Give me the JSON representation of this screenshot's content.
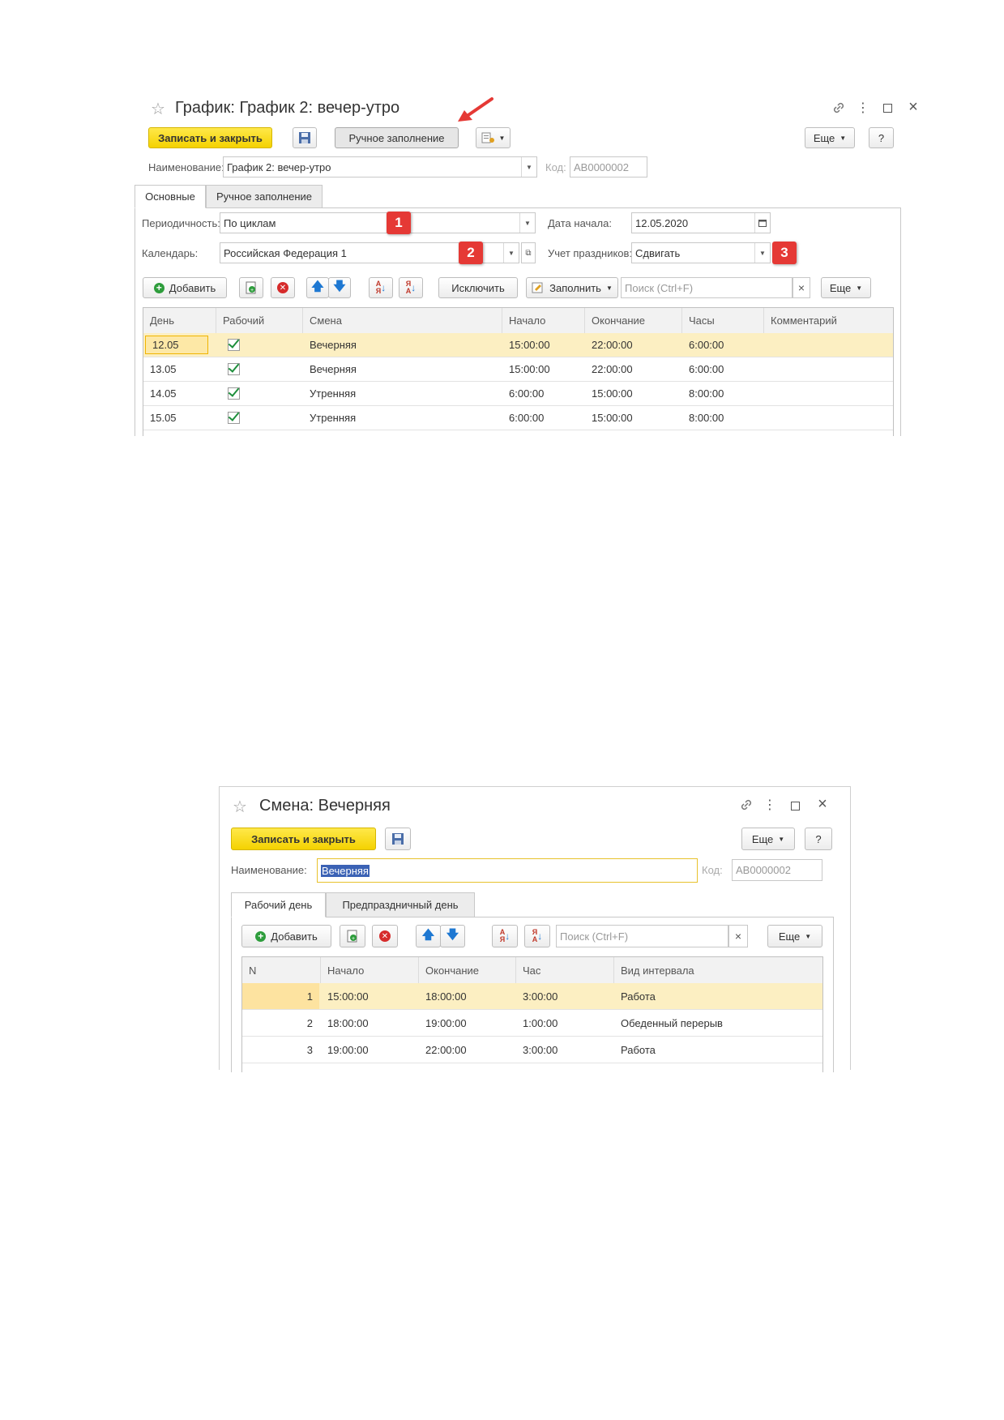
{
  "window1": {
    "title": "График: График 2: вечер-утро",
    "toolbar": {
      "save_close": "Записать и закрыть",
      "manual_fill": "Ручное заполнение",
      "more": "Еще",
      "help": "?"
    },
    "name_label": "Наименование:",
    "name_value": "График 2: вечер-утро",
    "code_label": "Код:",
    "code_value": "АВ0000002",
    "tabs": [
      "Основные",
      "Ручное заполнение"
    ],
    "periodicity_label": "Периодичность:",
    "periodicity_value": "По циклам",
    "start_date_label": "Дата начала:",
    "start_date_value": "12.05.2020",
    "calendar_label": "Календарь:",
    "calendar_value": "Российская Федерация 1",
    "holidays_label": "Учет праздников:",
    "holidays_value": "Сдвигать",
    "badges": [
      "1",
      "2",
      "3"
    ],
    "table_toolbar": {
      "add": "Добавить",
      "exclude": "Исключить",
      "fill": "Заполнить",
      "search_placeholder": "Поиск (Ctrl+F)",
      "clear": "×",
      "more": "Еще"
    },
    "columns": [
      "День",
      "Рабочий",
      "Смена",
      "Начало",
      "Окончание",
      "Часы",
      "Комментарий"
    ],
    "rows": [
      {
        "day": "12.05",
        "shift": "Вечерняя",
        "start": "15:00:00",
        "end": "22:00:00",
        "hours": "6:00:00"
      },
      {
        "day": "13.05",
        "shift": "Вечерняя",
        "start": "15:00:00",
        "end": "22:00:00",
        "hours": "6:00:00"
      },
      {
        "day": "14.05",
        "shift": "Утренняя",
        "start": "6:00:00",
        "end": "15:00:00",
        "hours": "8:00:00"
      },
      {
        "day": "15.05",
        "shift": "Утренняя",
        "start": "6:00:00",
        "end": "15:00:00",
        "hours": "8:00:00"
      }
    ]
  },
  "window2": {
    "title": "Смена: Вечерняя",
    "toolbar": {
      "save_close": "Записать и закрыть",
      "more": "Еще",
      "help": "?"
    },
    "name_label": "Наименование:",
    "name_value": "Вечерняя",
    "code_label": "Код:",
    "code_value": "АВ0000002",
    "tabs": [
      "Рабочий день",
      "Предпраздничный день"
    ],
    "table_toolbar": {
      "add": "Добавить",
      "search_placeholder": "Поиск (Ctrl+F)",
      "clear": "×",
      "more": "Еще"
    },
    "columns": [
      "N",
      "Начало",
      "Окончание",
      "Час",
      "Вид интервала"
    ],
    "rows": [
      {
        "n": "1",
        "start": "15:00:00",
        "end": "18:00:00",
        "hours": "3:00:00",
        "type": "Работа"
      },
      {
        "n": "2",
        "start": "18:00:00",
        "end": "19:00:00",
        "hours": "1:00:00",
        "type": "Обеденный перерыв"
      },
      {
        "n": "3",
        "start": "19:00:00",
        "end": "22:00:00",
        "hours": "3:00:00",
        "type": "Работа"
      }
    ]
  },
  "colors": {
    "primary_button": "#f4d200",
    "selected_row": "#fcefc2",
    "badge": "#e53935",
    "annotation_arrow": "#e53935",
    "checkmark": "#1e8f3c"
  }
}
